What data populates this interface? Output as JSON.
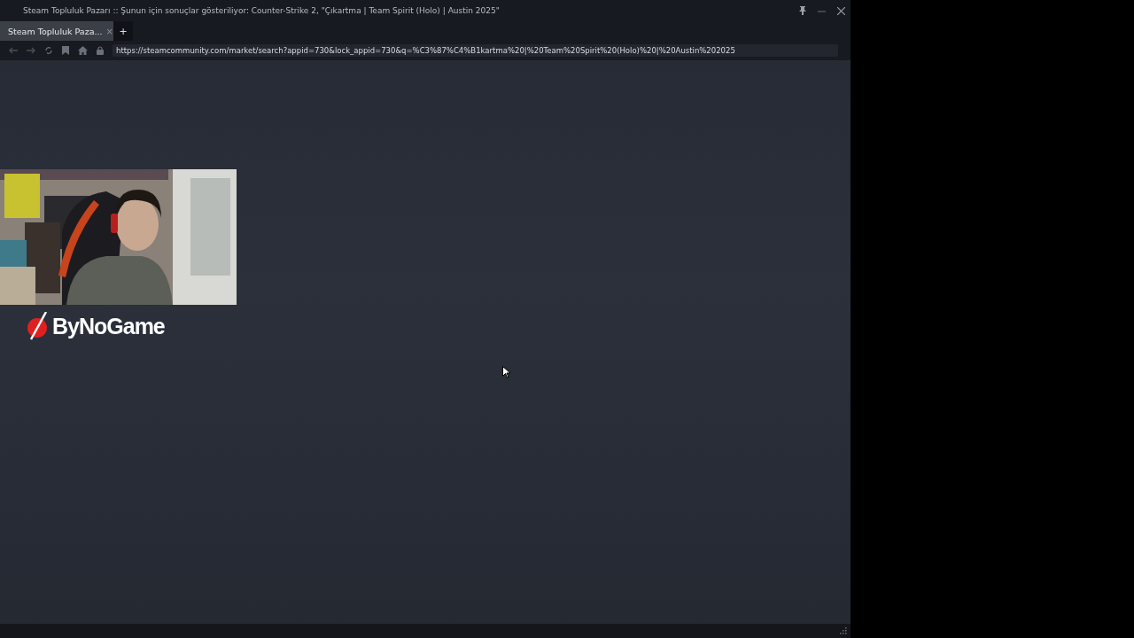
{
  "window": {
    "title": "Steam Topluluk Pazarı :: Şunun için sonuçlar gösteriliyor: Counter-Strike 2, \"Çıkartma | Team Spirit (Holo) | Austin 2025\""
  },
  "tabs": [
    {
      "label": "Steam Topluluk Paza...",
      "close": "×",
      "selected": true
    }
  ],
  "new_tab": "+",
  "address_bar": {
    "url": "https://steamcommunity.com/market/search?appid=730&lock_appid=730&q=%C3%87%C4%B1kartma%20|%20Team%20Spirit%20(Holo)%20|%20Austin%202025"
  },
  "overlay": {
    "kind": "picture",
    "logo": "ByNoGame"
  }
}
